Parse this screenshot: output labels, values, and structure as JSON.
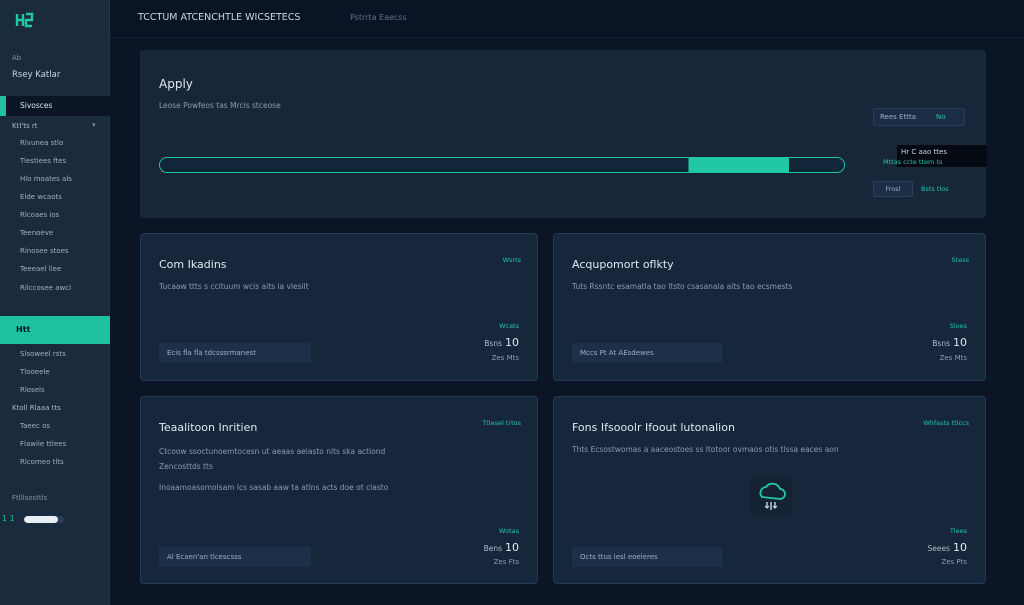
{
  "sidebar": {
    "caption": "Ab",
    "title": "Rsey Katlar",
    "active_item": "Sivosces",
    "groups": [
      {
        "label": "Ktl'ts rt",
        "items": [
          "Rlvunea stlo",
          "Tiestiees ftes",
          "Hlo moates als",
          "Elde wcaots",
          "Rlcoaes ios",
          "Teenoeve",
          "Rinosee stoes",
          "Teeeael llee",
          "Rilccosee awcl"
        ]
      }
    ],
    "teal_label": "Htt",
    "group2_items": [
      "Slsoweel rsts",
      "Tlooeele",
      "Rlosels"
    ],
    "group3_label": "Ktoll Rlaaa tts",
    "group3_items": [
      "Taeec os",
      "Flawiie ttlees",
      "Rlcomeo tlts"
    ],
    "footer_caption": "Ftlllsosttls",
    "progress_label": "1 1",
    "progress_fraction": 0.85
  },
  "topbar": {
    "title": "TCCTUM ATCENCHTLE WICSETECS",
    "subtitle": "Pstrrta Eaecss"
  },
  "apply": {
    "title": "Apply",
    "description": "Leose Powfeos tas Mrcis stceose",
    "progress_fraction": 0.92,
    "chip_a": "Rees Ettta",
    "chip_b": "No",
    "dark_a": "Hr C aao ttes",
    "dark_b": "Mttas ccte ttem ts",
    "button": "Frosl",
    "link": "Bsts tlos"
  },
  "cards": [
    {
      "title": "Com Ikadins",
      "tag": "Wsrts",
      "desc": [
        "Tucaaw ttts s ccituum wcis aits ia vlesilt"
      ],
      "button": "Ecis fla fla tdcsssrmanest",
      "small": "Wcats",
      "val_label": "Bsns",
      "val_num": "10",
      "sub": "Zes Mts"
    },
    {
      "title": "Acqupomort oflkty",
      "tag": "Stess",
      "desc": [
        "Tuts Rssntc esamatla tao ltsto csasanala aits tao ecsmests"
      ],
      "button": "Mccs Pt At AEsdewes",
      "small": "Sloes",
      "val_label": "Bsns",
      "val_num": "10",
      "sub": "Zes Mts"
    },
    {
      "title": "Teaalitoon Inritien",
      "tag": "Ttlesel trtos",
      "desc": [
        "Ctcoow ssoctunoemtocesn ut aeaas aeiasto nits ska actiond",
        "Zencosttds tts",
        "Inoaamoasomolsam lcs sasab aaw ta atlns acts doe ot clasto"
      ],
      "button": "Al Ecaen'an tlcescsss",
      "small": "Wotas",
      "val_label": "Bens",
      "val_num": "10",
      "sub": "Zes Fts"
    },
    {
      "title": "Fons Ifsooolr Ifoout lutonalion",
      "tag": "Whfasts ttlccs",
      "desc": [
        "Thts Ecsostwomas a aaceostoes ss ltotoor ovmaos otis tlssa eaces aon"
      ],
      "button": "Octs ttus iesl eoeleres",
      "small": "Tlees",
      "val_label": "Seees",
      "val_num": "10",
      "sub": "Zes Pts",
      "icon": "cloud-icon"
    }
  ],
  "colors": {
    "accent": "#1fc2a0",
    "bg": "#0b1526",
    "panel": "#16263b"
  }
}
